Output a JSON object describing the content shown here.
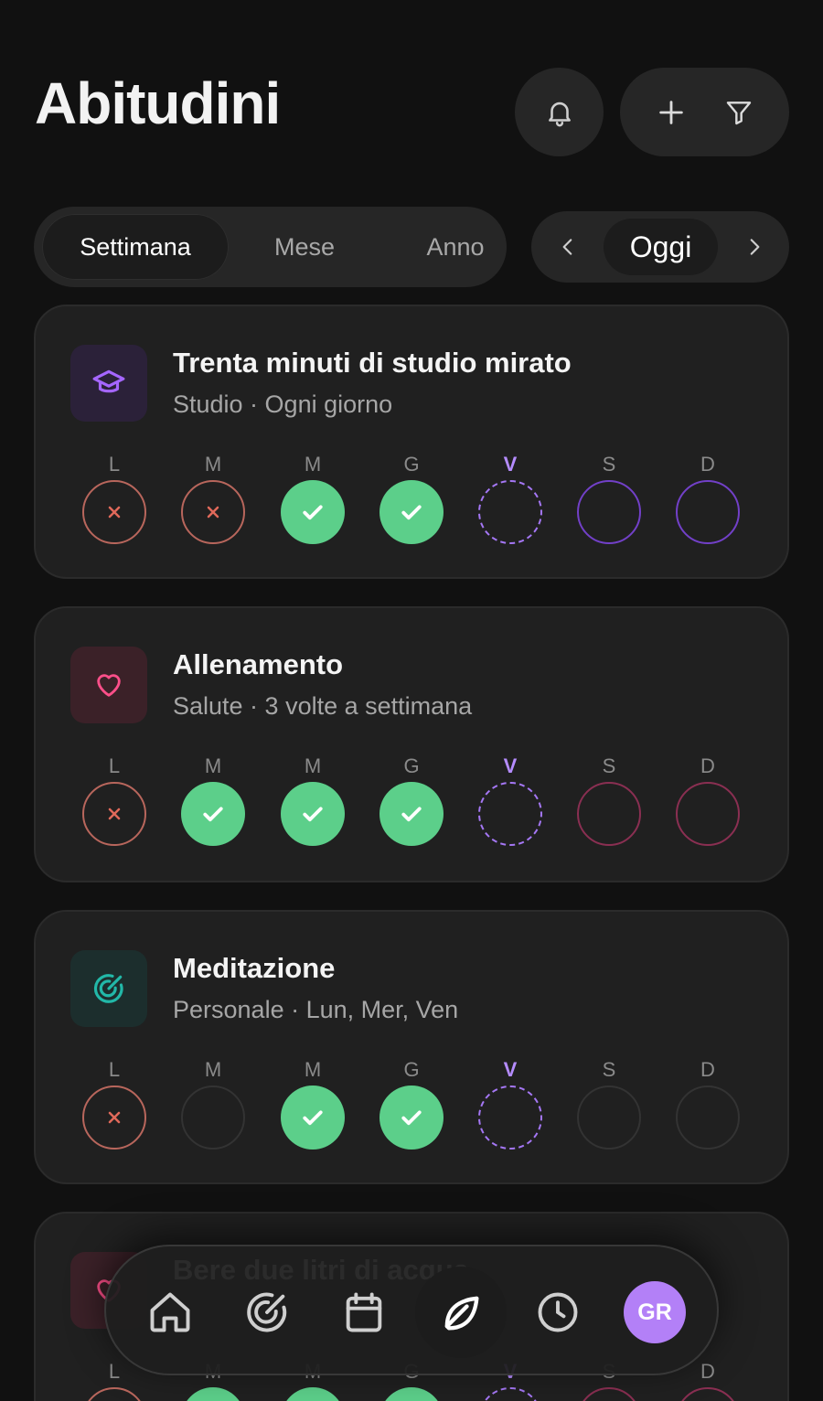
{
  "header": {
    "title": "Abitudini"
  },
  "segmented": {
    "items": [
      "Settimana",
      "Mese",
      "Anno"
    ],
    "active": 0
  },
  "date_nav": {
    "label": "Oggi"
  },
  "week_labels": [
    "L",
    "M",
    "M",
    "G",
    "V",
    "S",
    "D"
  ],
  "colors": {
    "accent": "#b58cff",
    "done": "#5ccf8a",
    "fail": "#e0695a",
    "card_bg": "#202020",
    "background": "#111111"
  },
  "habits": [
    {
      "title": "Trenta minuti di studio mirato",
      "subtitle": "Studio · Ogni giorno",
      "icon": "graduation-cap-icon",
      "icon_color": "#a566ff",
      "icon_bg": "#2b2139",
      "pending_color": "#7240c8",
      "days": [
        "fail",
        "fail",
        "done",
        "done",
        "today",
        "pending",
        "pending"
      ]
    },
    {
      "title": "Allenamento",
      "subtitle": "Salute · 3 volte a settimana",
      "icon": "heart-icon",
      "icon_color": "#ff4f8a",
      "icon_bg": "#3b2128",
      "pending_color": "#8a2f52",
      "days": [
        "fail",
        "done",
        "done",
        "done",
        "today",
        "pending",
        "pending"
      ]
    },
    {
      "title": "Meditazione",
      "subtitle": "Personale · Lun, Mer, Ven",
      "icon": "target-icon",
      "icon_color": "#22b8a8",
      "icon_bg": "#1c2e2d",
      "pending_color": "#333333",
      "days": [
        "fail",
        "empty",
        "done",
        "done",
        "today",
        "empty",
        "empty"
      ]
    },
    {
      "title": "Bere due litri di acqua",
      "subtitle": "",
      "icon": "heart-icon",
      "icon_color": "#ff4f8a",
      "icon_bg": "#3b2128",
      "pending_color": "#8a2f52",
      "days": [
        "fail",
        "done",
        "done",
        "done",
        "today",
        "pending",
        "pending"
      ]
    }
  ],
  "bottom_nav": {
    "items": [
      "home-icon",
      "target-icon",
      "calendar-icon",
      "leaf-icon",
      "clock-icon"
    ],
    "active": 3,
    "avatar_initials": "GR"
  }
}
